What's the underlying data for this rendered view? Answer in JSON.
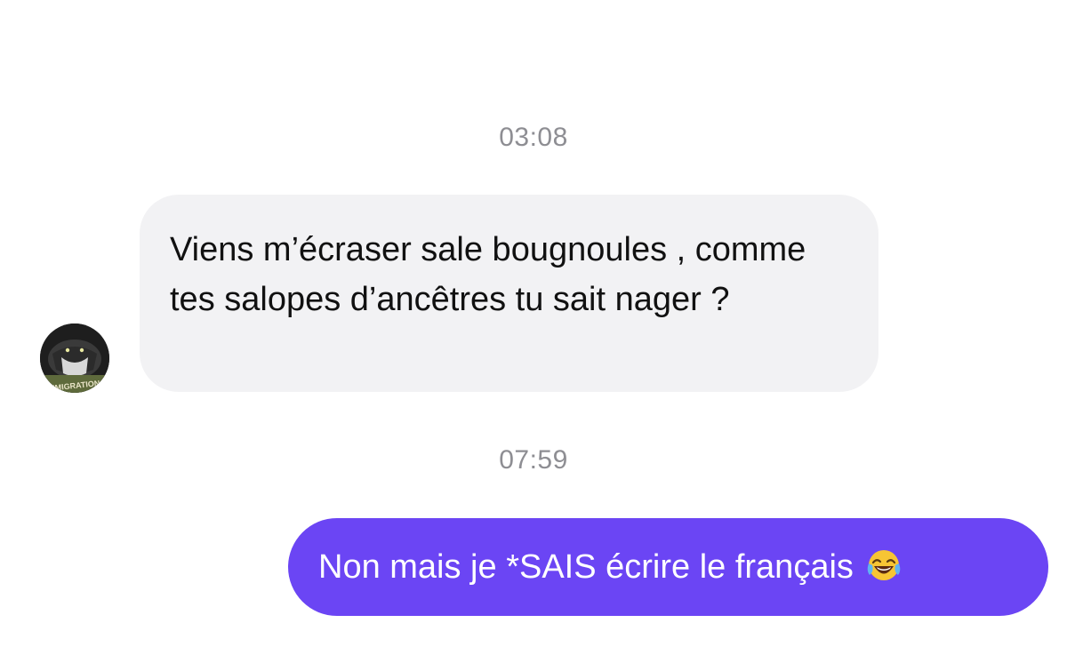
{
  "conversation": {
    "messages": [
      {
        "time": "03:08",
        "direction": "incoming",
        "text": "Viens m’écraser sale bougnoules , comme tes salopes d’ancêtres tu sait nager ?",
        "avatar_text": "EMIGRATION"
      },
      {
        "time": "07:59",
        "direction": "outgoing",
        "text": "Non mais je *SAIS écrire le français",
        "emoji": "face-with-tears-of-joy"
      }
    ]
  },
  "colors": {
    "incoming_bubble": "#f2f2f4",
    "outgoing_bubble": "#6b45f4",
    "timestamp": "#8e8e93"
  }
}
